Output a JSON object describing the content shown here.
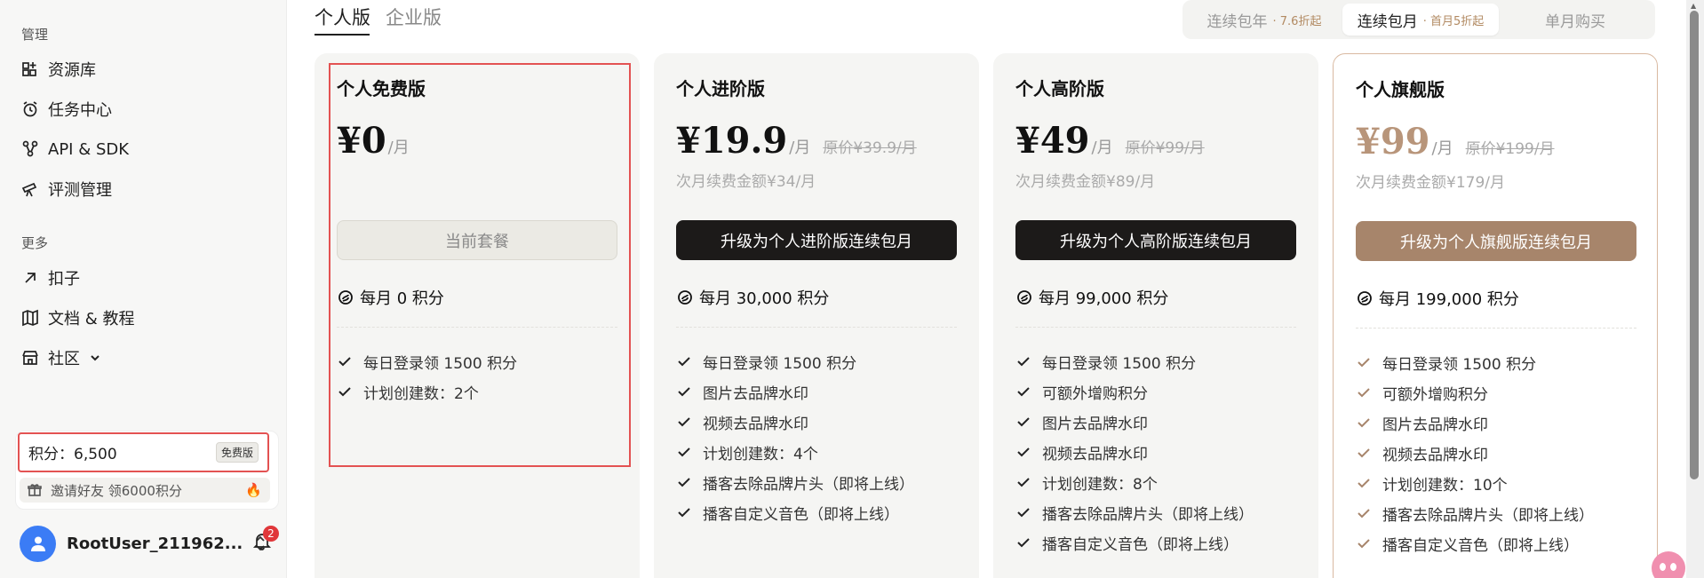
{
  "sidebar": {
    "manage_label": "管理",
    "manage_items": [
      {
        "label": "资源库",
        "icon": "grid-plus-icon"
      },
      {
        "label": "任务中心",
        "icon": "alarm-clock-icon"
      },
      {
        "label": "API & SDK",
        "icon": "api-nodes-icon"
      },
      {
        "label": "评测管理",
        "icon": "telescope-icon"
      }
    ],
    "more_label": "更多",
    "more_items": [
      {
        "label": "扣子",
        "icon": "arrow-up-right-icon"
      },
      {
        "label": "文档 & 教程",
        "icon": "map-icon"
      },
      {
        "label": "社区",
        "icon": "store-icon"
      }
    ],
    "points": {
      "label": "积分：6,500",
      "badge": "免费版"
    },
    "invite": {
      "label": "邀请好友 领6000积分",
      "icon": "gift-icon",
      "suffix": "🔥"
    },
    "user": {
      "name": "RootUser_211962...",
      "notifications": "2"
    }
  },
  "tabs": [
    {
      "label": "个人版",
      "active": true
    },
    {
      "label": "企业版",
      "active": false
    }
  ],
  "billing": {
    "options": [
      {
        "label": "连续包年",
        "discount": "· 7.6折起",
        "active": false
      },
      {
        "label": "连续包月",
        "discount": "· 首月5折起",
        "active": true
      },
      {
        "label": "单月购买",
        "discount": "",
        "active": false
      }
    ]
  },
  "plans": [
    {
      "name": "个人免费版",
      "price": "¥0",
      "per": "/月",
      "original": "",
      "renew": "",
      "cta": "当前套餐",
      "credits": "每月 0 积分",
      "features": [
        "每日登录领 1500 积分",
        "计划创建数：2个"
      ]
    },
    {
      "name": "个人进阶版",
      "price": "¥19.9",
      "per": "/月",
      "original": "原价¥39.9/月",
      "renew": "次月续费金额¥34/月",
      "cta": "升级为个人进阶版连续包月",
      "credits": "每月 30,000 积分",
      "features": [
        "每日登录领 1500 积分",
        "图片去品牌水印",
        "视频去品牌水印",
        "计划创建数：4个",
        "播客去除品牌片头（即将上线）",
        "播客自定义音色（即将上线）"
      ]
    },
    {
      "name": "个人高阶版",
      "price": "¥49",
      "per": "/月",
      "original": "原价¥99/月",
      "renew": "次月续费金额¥89/月",
      "cta": "升级为个人高阶版连续包月",
      "credits": "每月 99,000 积分",
      "features": [
        "每日登录领 1500 积分",
        "可额外增购积分",
        "图片去品牌水印",
        "视频去品牌水印",
        "计划创建数：8个",
        "播客去除品牌片头（即将上线）",
        "播客自定义音色（即将上线）"
      ]
    },
    {
      "name": "个人旗舰版",
      "price": "¥99",
      "per": "/月",
      "original": "原价¥199/月",
      "renew": "次月续费金额¥179/月",
      "cta": "升级为个人旗舰版连续包月",
      "credits": "每月 199,000 积分",
      "features": [
        "每日登录领 1500 积分",
        "可额外增购积分",
        "图片去品牌水印",
        "视频去品牌水印",
        "计划创建数：10个",
        "播客去除品牌片头（即将上线）",
        "播客自定义音色（即将上线）"
      ]
    }
  ],
  "colors": {
    "accent_brown": "#a7856b",
    "highlight_red": "#e35252",
    "avatar_blue": "#3b7cf5"
  }
}
